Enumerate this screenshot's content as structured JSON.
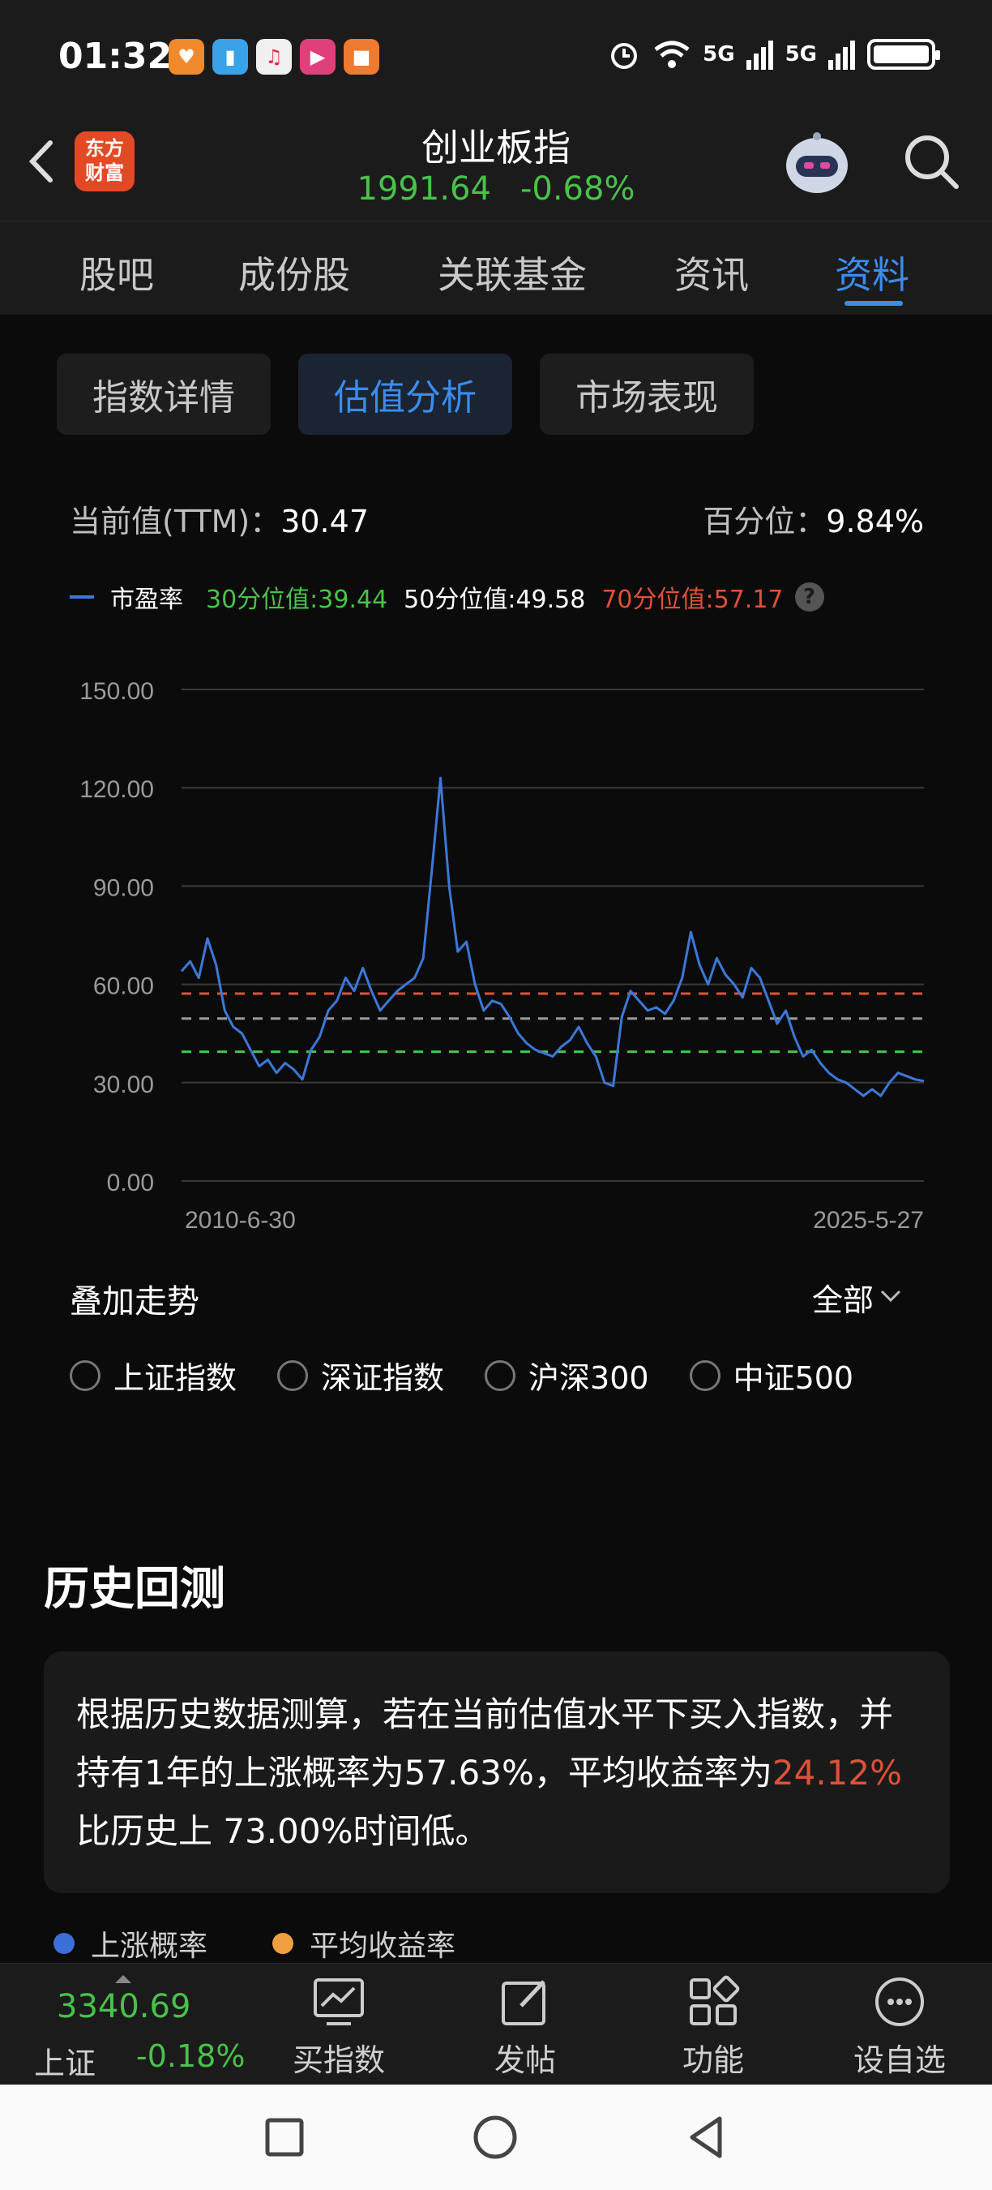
{
  "status_bar": {
    "time": "01:32",
    "network_1": "5G",
    "network_2": "5G"
  },
  "header": {
    "title": "创业板指",
    "price": "1991.64",
    "change": "-0.68%",
    "brand_line1": "东方",
    "brand_line2": "财富"
  },
  "tabs": [
    {
      "label": "股吧"
    },
    {
      "label": "成份股"
    },
    {
      "label": "关联基金"
    },
    {
      "label": "资讯"
    },
    {
      "label": "资料"
    }
  ],
  "subtabs": [
    {
      "label": "指数详情"
    },
    {
      "label": "估值分析"
    },
    {
      "label": "市场表现"
    }
  ],
  "metrics": {
    "current_label": "当前值(TTM)：",
    "current_value": "30.47",
    "percentile_label": "百分位：",
    "percentile_value": "9.84%"
  },
  "legend": {
    "pe": "市盈率",
    "p30": "30分位值:39.44",
    "p50": "50分位值:49.58",
    "p70": "70分位值:57.17",
    "help": "?"
  },
  "chart_data": {
    "type": "line",
    "series": [
      {
        "name": "市盈率",
        "color": "#3c78d8",
        "values": [
          64,
          67,
          62,
          74,
          66,
          52,
          47,
          45,
          40,
          35,
          37,
          33,
          36,
          34,
          31,
          40,
          44,
          52,
          55,
          62,
          58,
          65,
          58,
          52,
          55,
          58,
          60,
          62,
          68,
          95,
          123,
          90,
          70,
          73,
          60,
          52,
          55,
          54,
          50,
          45,
          42,
          40,
          39,
          38,
          41,
          43,
          47,
          42,
          38,
          30,
          29,
          50,
          58,
          55,
          52,
          53,
          51,
          55,
          62,
          76,
          66,
          60,
          68,
          63,
          60,
          56,
          65,
          62,
          55,
          48,
          52,
          44,
          38,
          40,
          36,
          33,
          31,
          30,
          28,
          26,
          28,
          26,
          30,
          33,
          32,
          31,
          30.5
        ]
      }
    ],
    "reference_lines": [
      {
        "name": "70分位值",
        "value": 57.17,
        "color": "#e0503a"
      },
      {
        "name": "50分位值",
        "value": 49.58,
        "color": "#9a9a9a"
      },
      {
        "name": "30分位值",
        "value": 39.44,
        "color": "#49c24a"
      }
    ],
    "y_ticks": [
      "150.00",
      "120.00",
      "90.00",
      "60.00",
      "30.00",
      "0.00"
    ],
    "ylim": [
      0,
      150
    ],
    "x_ticks": [
      "2010-6-30",
      "2025-5-27"
    ],
    "grid": true
  },
  "overlay": {
    "title": "叠加走势",
    "range": "全部",
    "options": [
      {
        "label": "上证指数"
      },
      {
        "label": "深证指数"
      },
      {
        "label": "沪深300"
      },
      {
        "label": "中证500"
      }
    ]
  },
  "backtest": {
    "title": "历史回测",
    "text_1": "根据历史数据测算，若在当前估值水平下买入指数，并持有1年的上涨概率为57.63%，平均收益率为",
    "highlight": "24.12%",
    "text_2": "比历史上 73.00%时间低。",
    "legend_up": "上涨概率",
    "legend_return": "平均收益率",
    "color_up": "#3c6fd8",
    "color_return": "#f0a040"
  },
  "bottom_bar": {
    "index_value": "3340.69",
    "index_name": "上证",
    "index_change": "-0.18%",
    "items": [
      {
        "label": "买指数"
      },
      {
        "label": "发帖"
      },
      {
        "label": "功能"
      },
      {
        "label": "设自选"
      }
    ]
  }
}
